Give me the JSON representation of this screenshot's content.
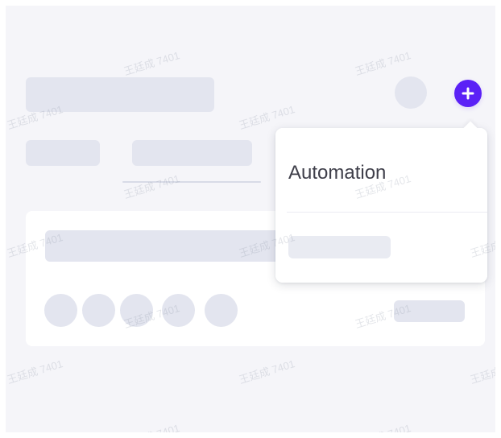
{
  "popover": {
    "title": "Automation"
  },
  "watermark_text": "王廷成 7401",
  "colors": {
    "accent": "#5b21f6",
    "skeleton": "#e3e5ef",
    "background": "#f5f5f9"
  },
  "icons": {
    "add_button": "plus-icon"
  }
}
